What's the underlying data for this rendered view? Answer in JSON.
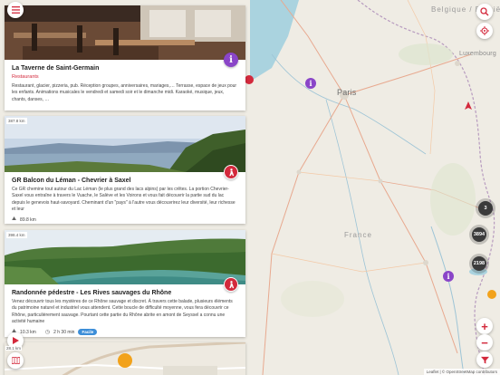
{
  "map": {
    "labels": {
      "belgique": "Belgique / België / Belgien",
      "luxembourg": "Luxembourg",
      "paris": "Paris",
      "france": "France"
    },
    "clusters": [
      "3",
      "3894",
      "2198"
    ],
    "attribution": "Leaflet | © OpenStreetMap contributors",
    "zoom_in": "+",
    "zoom_out": "−",
    "colors": {
      "accent": "#d3293c",
      "poi_info": "#8a45c8",
      "cluster": "#3b3b3b",
      "difficulty": "#3d8ed8"
    }
  },
  "cards": [
    {
      "title": "La Taverne de Saint-Germain",
      "category": "Restaurants",
      "description": "Restaurant, glacier, pizzeria, pub. Réception groupes, anniversaires, mariages,… Terrasse, espace de jeux pour les enfants. Animations musicales le vendredi et samedi soir et le dimanche midi. Karaoké, musique, jeux, chants, danses, …",
      "icon": "info-icon"
    },
    {
      "distance": "387.8 km",
      "title": "GR Balcon du Léman - Chevrier à Saxel",
      "description": "Ce GR chemine tout autour du Lac Léman (le plus grand des lacs alpins) par les crêtes. La portion Chevrier-Saxel vous entraîne à travers le Vuache, le Salève et les Voirons et vous fait découvrir la partie sud du lac depuis le genevois haut-savoyard. Cheminant d'un \"pays\" à l'autre vous découvrirez leur diversité, leur richesse et leur",
      "length": "89.8 km",
      "icon": "hike-icon"
    },
    {
      "distance": "398.4 km",
      "title": "Randonnée pédestre - Les Rives sauvages du Rhône",
      "description": "Venez découvrir tous les mystères de ce Rhône sauvage et discret. À travers cette balade, plusieurs éléments du patrimoine naturel et industriel vous attendent. Cette boucle de difficulté moyenne, vous fera découvrir ce Rhône, particulièrement sauvage. Pourtant cette partie du Rhône abrite en amont de Seyssel a connu une activité humaine",
      "length": "10.3 km",
      "duration": "2 h 30 min",
      "difficulty": "Facile",
      "icon": "hike-icon"
    }
  ],
  "fab_distance": "28.1 km"
}
